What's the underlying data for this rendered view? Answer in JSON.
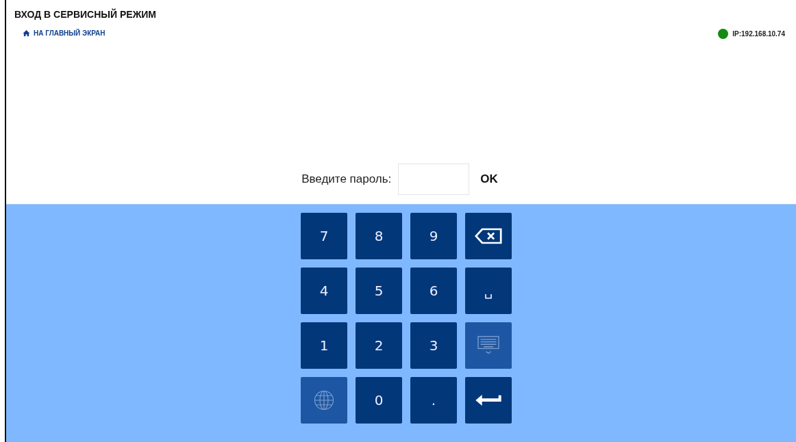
{
  "header": {
    "title": "ВХОД В СЕРВИСНЫЙ РЕЖИМ",
    "home_link": "НА ГЛАВНЫЙ ЭКРАН"
  },
  "status": {
    "color": "#138a13",
    "ip": "IP:192.168.10.74"
  },
  "password": {
    "label": "Введите пароль:",
    "ok": "OK"
  },
  "keypad": [
    {
      "kind": "char",
      "label": "7",
      "disabled": false
    },
    {
      "kind": "char",
      "label": "8",
      "disabled": false
    },
    {
      "kind": "char",
      "label": "9",
      "disabled": false
    },
    {
      "kind": "backspace",
      "disabled": false
    },
    {
      "kind": "char",
      "label": "4",
      "disabled": false
    },
    {
      "kind": "char",
      "label": "5",
      "disabled": false
    },
    {
      "kind": "char",
      "label": "6",
      "disabled": false
    },
    {
      "kind": "char",
      "label": "␣",
      "disabled": false
    },
    {
      "kind": "char",
      "label": "1",
      "disabled": false
    },
    {
      "kind": "char",
      "label": "2",
      "disabled": false
    },
    {
      "kind": "char",
      "label": "3",
      "disabled": false
    },
    {
      "kind": "hide-keyboard",
      "disabled": true
    },
    {
      "kind": "language",
      "disabled": true
    },
    {
      "kind": "char",
      "label": "0",
      "disabled": false
    },
    {
      "kind": "char",
      "label": ".",
      "disabled": false
    },
    {
      "kind": "enter",
      "disabled": false
    }
  ]
}
